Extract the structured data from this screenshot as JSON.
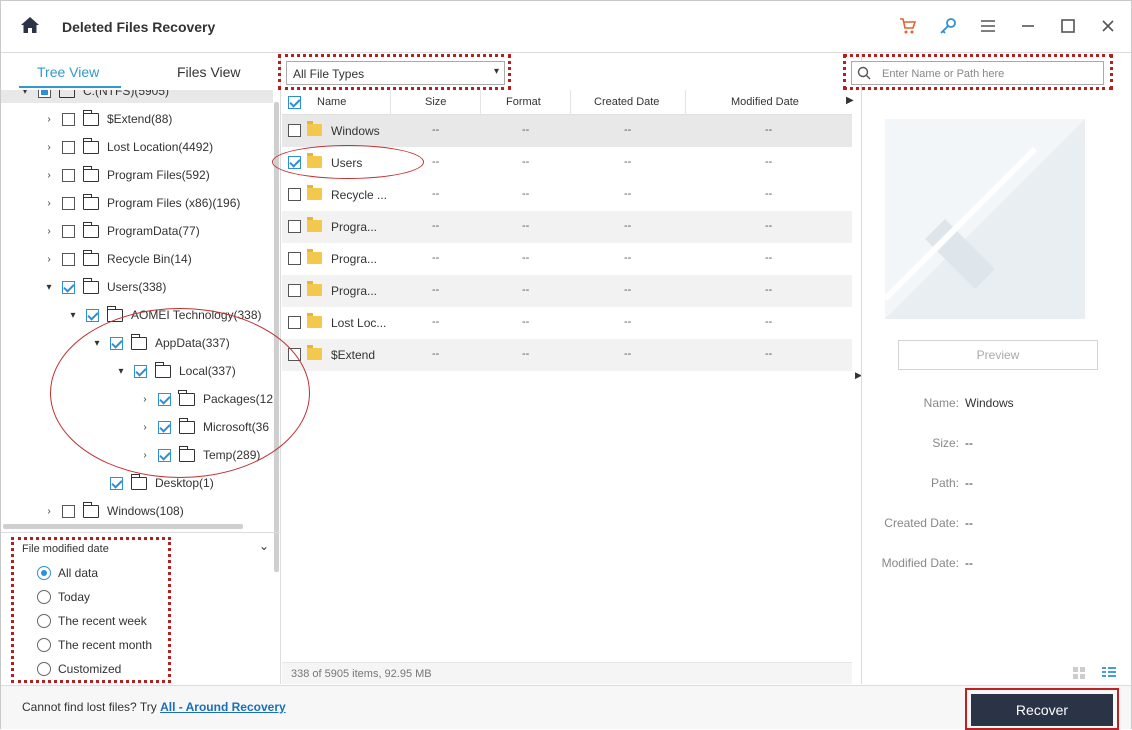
{
  "app": {
    "title": "Deleted Files Recovery"
  },
  "tabs": {
    "tree": "Tree View",
    "files": "Files View"
  },
  "tree": [
    {
      "label": "C:(NTFS)(5905)",
      "level": 0,
      "arrow": "▾",
      "check": "part",
      "first": true
    },
    {
      "label": "$Extend(88)",
      "level": 1,
      "arrow": "›",
      "check": "off"
    },
    {
      "label": "Lost Location(4492)",
      "level": 1,
      "arrow": "›",
      "check": "off"
    },
    {
      "label": "Program Files(592)",
      "level": 1,
      "arrow": "›",
      "check": "off"
    },
    {
      "label": "Program Files (x86)(196)",
      "level": 1,
      "arrow": "›",
      "check": "off"
    },
    {
      "label": "ProgramData(77)",
      "level": 1,
      "arrow": "›",
      "check": "off"
    },
    {
      "label": "Recycle Bin(14)",
      "level": 1,
      "arrow": "›",
      "check": "off"
    },
    {
      "label": "Users(338)",
      "level": 1,
      "arrow": "▾",
      "check": "on"
    },
    {
      "label": "AOMEI Technology(338)",
      "level": 2,
      "arrow": "▾",
      "check": "on"
    },
    {
      "label": "AppData(337)",
      "level": 3,
      "arrow": "▾",
      "check": "on"
    },
    {
      "label": "Local(337)",
      "level": 4,
      "arrow": "▾",
      "check": "on"
    },
    {
      "label": "Packages(12",
      "level": 5,
      "arrow": "›",
      "check": "on"
    },
    {
      "label": "Microsoft(36",
      "level": 5,
      "arrow": "›",
      "check": "on"
    },
    {
      "label": "Temp(289)",
      "level": 5,
      "arrow": "›",
      "check": "on"
    },
    {
      "label": "Desktop(1)",
      "level": 3,
      "arrow": "",
      "check": "on"
    },
    {
      "label": "Windows(108)",
      "level": 1,
      "arrow": "›",
      "check": "off"
    }
  ],
  "filter": {
    "title": "File modified date",
    "options": [
      "All data",
      "Today",
      "The recent week",
      "The recent month",
      "Customized"
    ],
    "selected": 0
  },
  "toolbar": {
    "file_type": "All File Types",
    "search_placeholder": "Enter Name or Path here"
  },
  "columns": [
    "Name",
    "Size",
    "Format",
    "Created Date",
    "Modified Date"
  ],
  "files": [
    {
      "name": "Windows",
      "size": "--",
      "format": "--",
      "created": "--",
      "modified": "--",
      "checked": false
    },
    {
      "name": "Users",
      "size": "--",
      "format": "--",
      "created": "--",
      "modified": "--",
      "checked": true
    },
    {
      "name": "Recycle ...",
      "size": "--",
      "format": "--",
      "created": "--",
      "modified": "--",
      "checked": false
    },
    {
      "name": "Progra...",
      "size": "--",
      "format": "--",
      "created": "--",
      "modified": "--",
      "checked": false
    },
    {
      "name": "Progra...",
      "size": "--",
      "format": "--",
      "created": "--",
      "modified": "--",
      "checked": false
    },
    {
      "name": "Progra...",
      "size": "--",
      "format": "--",
      "created": "--",
      "modified": "--",
      "checked": false
    },
    {
      "name": "Lost Loc...",
      "size": "--",
      "format": "--",
      "created": "--",
      "modified": "--",
      "checked": false
    },
    {
      "name": "$Extend",
      "size": "--",
      "format": "--",
      "created": "--",
      "modified": "--",
      "checked": false
    }
  ],
  "status": "338 of 5905 items, 92.95 MB",
  "preview": {
    "button": "Preview",
    "fields": [
      {
        "key": "Name:",
        "value": "Windows"
      },
      {
        "key": "Size:",
        "value": "--"
      },
      {
        "key": "Path:",
        "value": "--"
      },
      {
        "key": "Created Date:",
        "value": "--"
      },
      {
        "key": "Modified Date:",
        "value": "--"
      }
    ]
  },
  "bottom": {
    "help_text": "Cannot find lost files? Try",
    "help_link": "All - Around Recovery",
    "recover": "Recover"
  },
  "colors": {
    "accent": "#3399cc",
    "check": "#2e8fd6",
    "recover_bg": "#2b3346",
    "annotation": "#c02020"
  }
}
